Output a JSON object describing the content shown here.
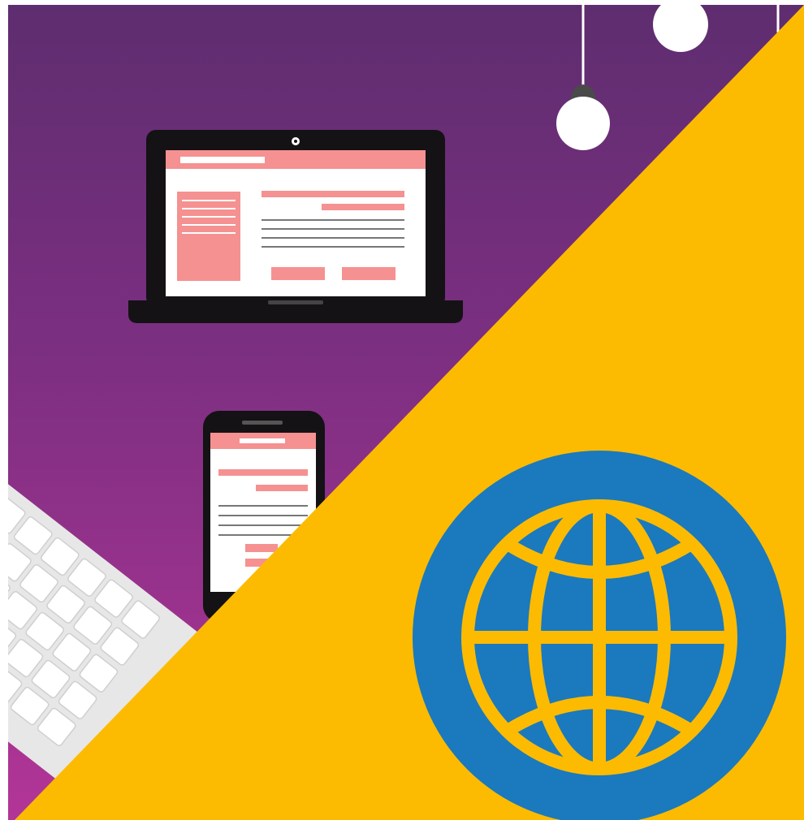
{
  "colors": {
    "background": "#ffffff",
    "purple_top": "#5e2d6f",
    "purple_mid": "#7e2f82",
    "purple_bottom": "#b23597",
    "accent_yellow": "#fcbb00",
    "globe_blue": "#1b79be",
    "screen_pink": "#f59191",
    "device_black": "#141214",
    "bulb_white": "#ffffff",
    "keyboard_gray": "#d9d9d9"
  },
  "icons": {
    "globe": "globe-icon",
    "laptop": "laptop-icon",
    "phone": "smartphone-icon",
    "bulb": "light-bulb-icon",
    "keyboard": "keyboard-icon"
  }
}
